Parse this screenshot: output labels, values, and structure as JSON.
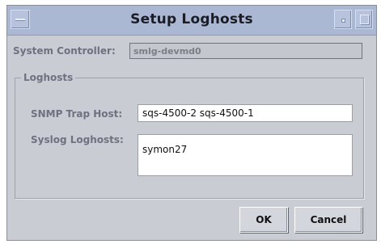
{
  "window": {
    "title": "Setup Loghosts",
    "menu_icon": "window-menu-icon",
    "minimize_icon": "minimize-icon",
    "maximize_icon": "maximize-icon"
  },
  "system_controller": {
    "label": "System Controller:",
    "value": "smlg-devmd0"
  },
  "loghosts": {
    "group_label": "Loghosts",
    "snmp_label": "SNMP Trap Host:",
    "snmp_value": "sqs-4500-2 sqs-4500-1",
    "syslog_label": "Syslog Loghosts:",
    "syslog_value": "symon27"
  },
  "buttons": {
    "ok": "OK",
    "cancel": "Cancel"
  },
  "colors": {
    "titlebar": "#aab8d4",
    "window_bg": "#c9ccd2",
    "field_bg": "#ffffff"
  }
}
